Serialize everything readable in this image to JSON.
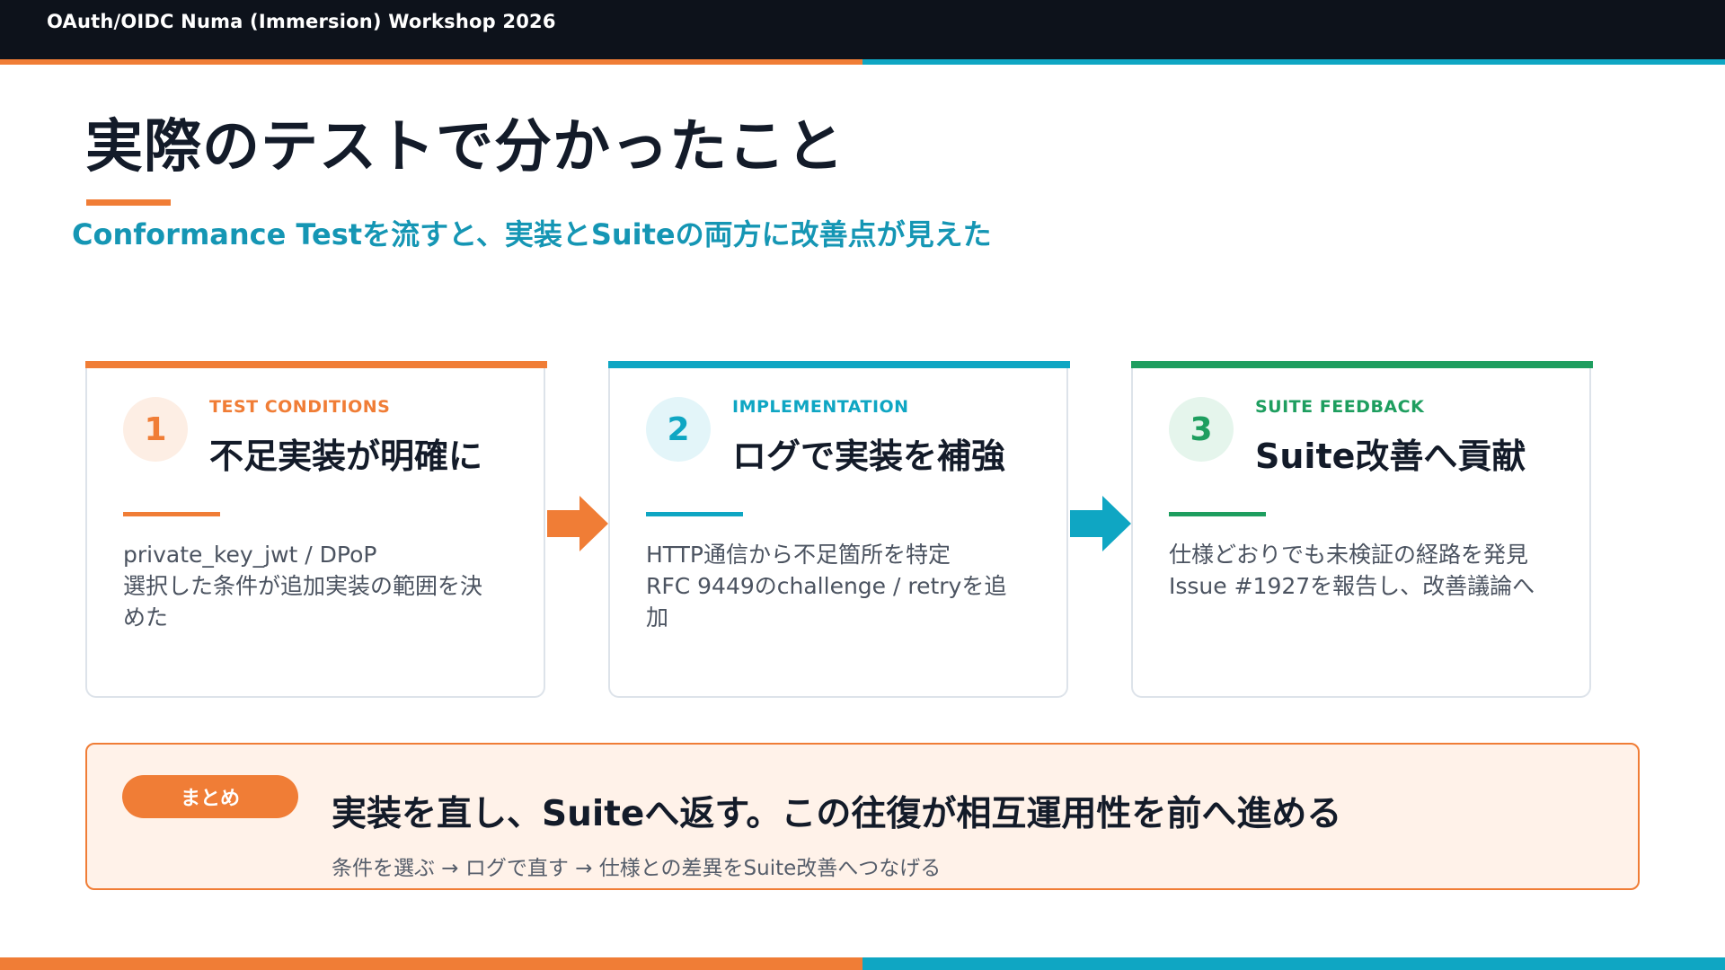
{
  "header": {
    "title": "OAuth/OIDC Numa (Immersion) Workshop 2026"
  },
  "page": {
    "title": "実際のテストで分かったこと",
    "subtitle": "Conformance Testを流すと、実装とSuiteの両方に改善点が見えた"
  },
  "colors": {
    "orange": "#f07d36",
    "teal": "#0fa6c3",
    "green": "#1e9e5f",
    "dark": "#0d121b",
    "subtitle": "#1596b4"
  },
  "cards": [
    {
      "number": "1",
      "label": "TEST CONDITIONS",
      "heading": "不足実装が明確に",
      "lines": [
        "private_key_jwt / DPoP",
        "選択した条件が追加実装の範囲を決",
        "めた"
      ],
      "accent": "#f07d36",
      "tint": "#fdeee4"
    },
    {
      "number": "2",
      "label": "IMPLEMENTATION",
      "heading": "ログで実装を補強",
      "lines": [
        "HTTP通信から不足箇所を特定",
        "RFC 9449のchallenge / retryを追",
        "加"
      ],
      "accent": "#0fa6c3",
      "tint": "#e3f5f9"
    },
    {
      "number": "3",
      "label": "SUITE FEEDBACK",
      "heading": "Suite改善へ貢献",
      "lines": [
        "仕様どおりでも未検証の経路を発見",
        "Issue #1927を報告し、改善議論へ"
      ],
      "accent": "#1e9e5f",
      "tint": "#e5f5ec"
    }
  ],
  "arrows": [
    {
      "icon": "arrow-right-icon",
      "color": "#f07d36"
    },
    {
      "icon": "arrow-right-icon",
      "color": "#0fa6c3"
    }
  ],
  "summary": {
    "pill": "まとめ",
    "main": "実装を直し、Suiteへ返す。この往復が相互運用性を前へ進める",
    "sub": "条件を選ぶ → ログで直す → 仕様との差異をSuite改善へつなげる"
  }
}
